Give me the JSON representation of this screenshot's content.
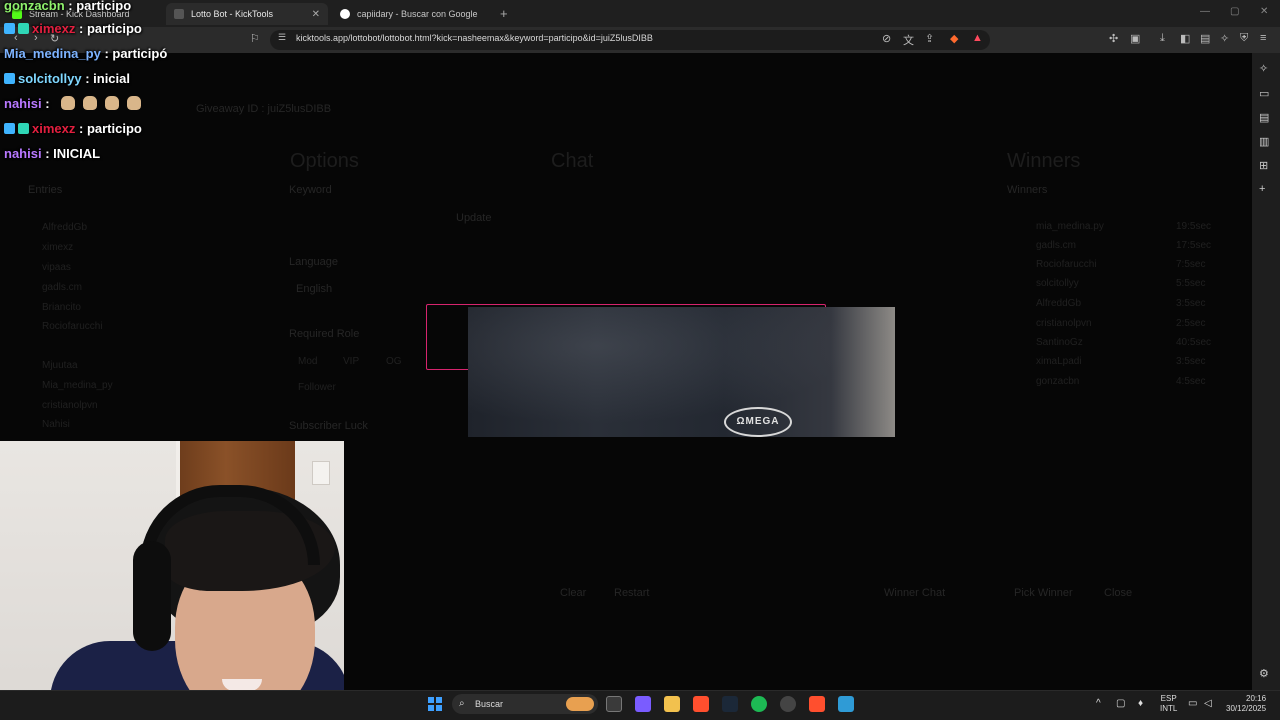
{
  "browser": {
    "tabs": [
      {
        "label": "Stream - Kick Dashboard",
        "active": false
      },
      {
        "label": "Lotto Bot - KickTools",
        "active": true
      },
      {
        "label": "capiidary - Buscar con Google",
        "active": false
      }
    ],
    "new_tab": "+",
    "url": "kicktools.app/lottobot/lottobot.html?kick=nasheemax&keyword=participo&id=juiZ5lusDIBB"
  },
  "lottobot_page": {
    "giveaway_id": "Giveaway ID : juiZ5lusDIBB",
    "options_heading": "Options",
    "chat_heading": "Chat",
    "winners_heading": "Winners",
    "keyword_label": "Keyword",
    "update_button": "Update",
    "language_label": "Language",
    "language_value": "English",
    "required_role_label": "Required Role",
    "roles": [
      "Mod",
      "VIP",
      "OG"
    ],
    "follower": "Follower",
    "subscriber_luck": "Subscriber Luck",
    "entries_label": "Entries",
    "entries": [
      "AlfreddGb",
      "ximexz",
      "vipaas",
      "gadls.cm",
      "Briancito",
      "Rociofarucchi",
      "Mjuutaa",
      "Mia_medina_py",
      "cristianolpvn",
      "Nahisi"
    ],
    "winners_list_label": "Winners",
    "winners": [
      {
        "name": "mia_medina.py",
        "time": "19:5sec"
      },
      {
        "name": "gadls.cm",
        "time": "17:5sec"
      },
      {
        "name": "Rociofarucchi",
        "time": "7:5sec"
      },
      {
        "name": "solcitollyy",
        "time": "5:5sec"
      },
      {
        "name": "AlfreddGb",
        "time": "3:5sec"
      },
      {
        "name": "cristianolpvn",
        "time": "2:5sec"
      },
      {
        "name": "SantinoGz",
        "time": "40:5sec"
      },
      {
        "name": "ximaLpadi",
        "time": "3:5sec"
      },
      {
        "name": "gonzacbn",
        "time": "4:5sec"
      }
    ],
    "chat_button": "Clear",
    "restart_button": "Restart",
    "winner_chat": "Winner Chat",
    "pick_winner": "Pick Winner",
    "close": "Close"
  },
  "chat_overlay": [
    {
      "user": "gonzacbn",
      "msg": "participo",
      "color": "u-green",
      "badges": 0
    },
    {
      "user": "ximexz",
      "msg": "participo",
      "color": "u-red",
      "badges": 2
    },
    {
      "user": "Mia_medina_py",
      "msg": "participó",
      "color": "u-blue",
      "badges": 0
    },
    {
      "user": "solcitollyy",
      "msg": "inicial",
      "color": "u-cyan",
      "badges": 1
    },
    {
      "user": "nahisi",
      "msg": "",
      "color": "u-purple",
      "badges": 0,
      "hands": 4
    },
    {
      "user": "ximexz",
      "msg": "participo",
      "color": "u-red",
      "badges": 2
    },
    {
      "user": "nahisi",
      "msg": "INICIAL",
      "color": "u-purple",
      "badges": 0
    }
  ],
  "video_logo": "ΩMEGA",
  "taskbar": {
    "search_placeholder": "Buscar",
    "lang_top": "ESP",
    "lang_bottom": "INTL",
    "time": "20:16",
    "date": "30/12/2025"
  },
  "icons": {
    "tab_close": "close-icon",
    "bookmark": "bookmark-icon",
    "reload": "reload-icon",
    "shield": "shield-icon",
    "download": "download-icon",
    "menu": "menu-icon"
  }
}
